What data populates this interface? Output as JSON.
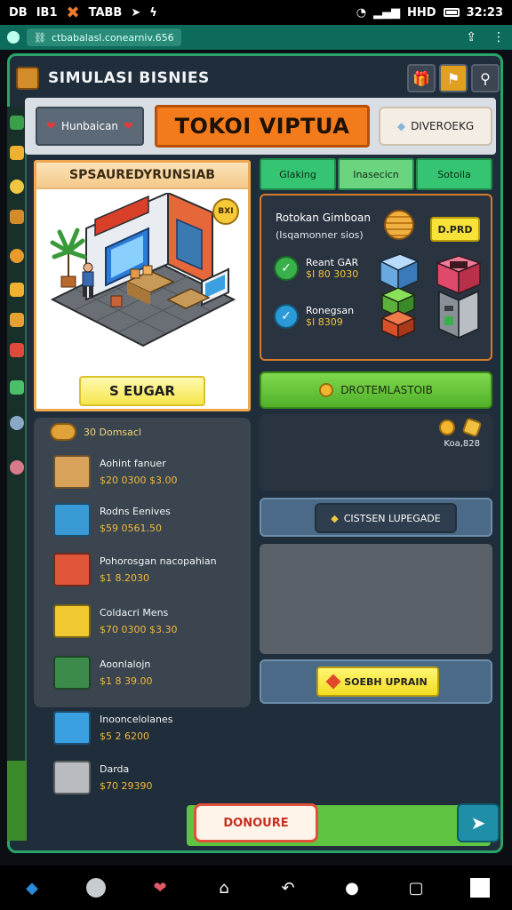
{
  "status_bar": {
    "left_text_1": "DB",
    "left_text_2": "IB1",
    "left_text_3": "TABB",
    "time": "32:23",
    "net_label": "HHD"
  },
  "browser": {
    "url": "ctbabalasl.conearniv.656"
  },
  "header": {
    "title": "SIMULASI BISNIES"
  },
  "toolbar": {
    "left_chip": "Hunbaican",
    "main_title": "TOKOI VIPTUA",
    "right_chip": "DIVEROEKG"
  },
  "showcase": {
    "title": "SPSAUREDYRUNSIAB",
    "price_badge": "BXI",
    "setup_button": "S EUGAR"
  },
  "tabs": [
    {
      "label": "Glaking"
    },
    {
      "label": "Inasecicn"
    },
    {
      "label": "Sotoila"
    }
  ],
  "info_panel": {
    "title": "Rotokan Gimboan",
    "subtitle": "(Isqamonner sios)",
    "tag": "D.PRD",
    "stats": [
      {
        "label": "Reant GAR",
        "value": "$I 80 3030"
      },
      {
        "label": "Ronegsan",
        "value": "$I 8309"
      }
    ]
  },
  "green_button": {
    "label": "DROTEMLASTOIB"
  },
  "coin_panel": {
    "value": "Koa,828"
  },
  "upgrade": {
    "label": "CISTSEN LUPEGADE"
  },
  "repair": {
    "label": "SOEBH UPRAIN"
  },
  "items": {
    "header": "30 Domsacl",
    "list": [
      {
        "name": "Aohint fanuer",
        "price": "$20 0300 $3.00",
        "color": "#d9a25a"
      },
      {
        "name": "Rodns Eenives",
        "price": "$59 0561.50",
        "color": "#3a9ad6"
      },
      {
        "name": "Pohorosgan nacopahian",
        "price": "$1 8.2030",
        "color": "#e0563a"
      },
      {
        "name": "Coldacri Mens",
        "price": "$70 0300 $3.30",
        "color": "#f0c830"
      },
      {
        "name": "Aoonlalojn",
        "price": "$1 8 39.00",
        "color": "#3c8b4a"
      },
      {
        "name": "Inooncelolanes",
        "price": "$5 2 6200",
        "color": "#3aa0e0"
      },
      {
        "name": "Darda",
        "price": "$70 29390",
        "color": "#b8bcc0"
      }
    ]
  },
  "footer": {
    "donate": "DONOURE"
  }
}
